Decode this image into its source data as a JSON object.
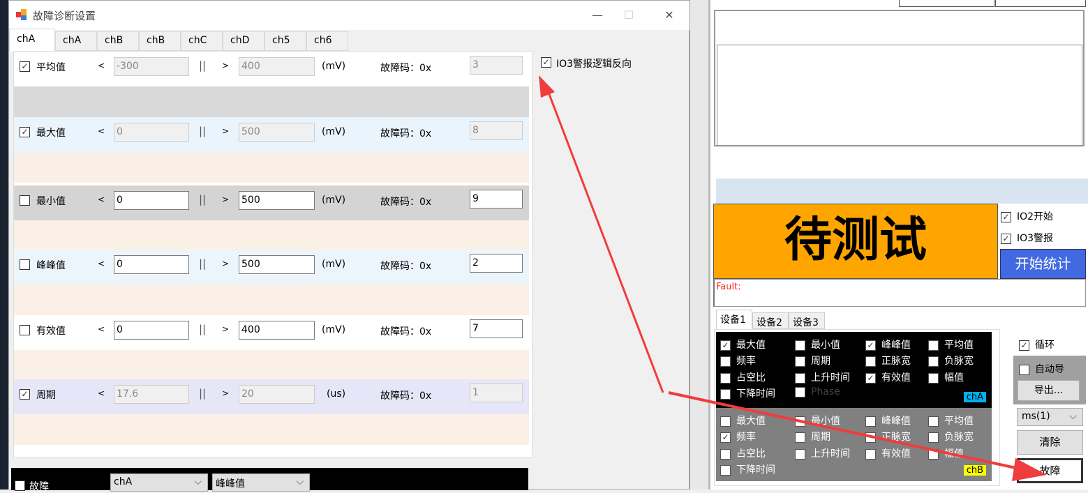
{
  "dialog": {
    "title": "故障诊断设置",
    "window_controls": {
      "minimize": "—",
      "maximize": "☐",
      "close": "✕"
    },
    "tabs": [
      "chA",
      "chA",
      "chB",
      "chB",
      "chC",
      "chD",
      "ch5",
      "ch6"
    ],
    "active_tab": 0,
    "rows": [
      {
        "label": "平均值",
        "checked": true,
        "lt": "<",
        "low": "-300",
        "sep": "||",
        "gt": ">",
        "high": "400",
        "unit": "(mV)",
        "code_label": "故障码：0x",
        "code": "3",
        "enabled": false
      },
      {
        "label": "最大值",
        "checked": true,
        "lt": "<",
        "low": "0",
        "sep": "||",
        "gt": ">",
        "high": "500",
        "unit": "(mV)",
        "code_label": "故障码：0x",
        "code": "8",
        "enabled": false
      },
      {
        "label": "最小值",
        "checked": false,
        "lt": "<",
        "low": "0",
        "sep": "||",
        "gt": ">",
        "high": "500",
        "unit": "(mV)",
        "code_label": "故障码：0x",
        "code": "9",
        "enabled": true
      },
      {
        "label": "峰峰值",
        "checked": false,
        "lt": "<",
        "low": "0",
        "sep": "||",
        "gt": ">",
        "high": "500",
        "unit": "(mV)",
        "code_label": "故障码：0x",
        "code": "2",
        "enabled": true
      },
      {
        "label": "有效值",
        "checked": false,
        "lt": "<",
        "low": "0",
        "sep": "||",
        "gt": ">",
        "high": "400",
        "unit": "(mV)",
        "code_label": "故障码：0x",
        "code": "7",
        "enabled": true
      },
      {
        "label": "周期",
        "checked": true,
        "lt": "<",
        "low": "17.6",
        "sep": "||",
        "gt": ">",
        "high": "20",
        "unit": "(us)",
        "code_label": "故障码：0x",
        "code": "1",
        "enabled": false
      }
    ],
    "io3_invert": {
      "label": "IO3警报逻辑反向",
      "checked": true
    },
    "bottom_bar": {
      "fault_label": "故障",
      "fault_checked": false,
      "channel_select": "chA",
      "measure_select": "峰峰值"
    }
  },
  "right": {
    "status_text": "待测试",
    "status_color": "#ffa500",
    "io2": {
      "label": "IO2开始",
      "checked": true
    },
    "io3": {
      "label": "IO3警报",
      "checked": true
    },
    "start_stats_button": "开始统计",
    "fault_label": "Fault:",
    "device_tabs": [
      "设备1",
      "设备2",
      "设备3"
    ],
    "chA_panel": {
      "badge": "chA",
      "items": [
        {
          "label": "最大值",
          "checked": true
        },
        {
          "label": "最小值",
          "checked": false
        },
        {
          "label": "峰峰值",
          "checked": true
        },
        {
          "label": "平均值",
          "checked": false
        },
        {
          "label": "频率",
          "checked": false
        },
        {
          "label": "周期",
          "checked": false
        },
        {
          "label": "正脉宽",
          "checked": false
        },
        {
          "label": "负脉宽",
          "checked": false
        },
        {
          "label": "占空比",
          "checked": false
        },
        {
          "label": "上升时间",
          "checked": false
        },
        {
          "label": "有效值",
          "checked": true
        },
        {
          "label": "幅值",
          "checked": false
        },
        {
          "label": "下降时间",
          "checked": false
        },
        {
          "label": "Phase",
          "checked": false
        }
      ]
    },
    "chB_panel": {
      "badge": "chB",
      "items": [
        {
          "label": "最大值",
          "checked": false
        },
        {
          "label": "最小值",
          "checked": false
        },
        {
          "label": "峰峰值",
          "checked": false
        },
        {
          "label": "平均值",
          "checked": false
        },
        {
          "label": "频率",
          "checked": true
        },
        {
          "label": "周期",
          "checked": false
        },
        {
          "label": "正脉宽",
          "checked": false
        },
        {
          "label": "负脉宽",
          "checked": false
        },
        {
          "label": "占空比",
          "checked": false
        },
        {
          "label": "上升时间",
          "checked": false
        },
        {
          "label": "有效值",
          "checked": false
        },
        {
          "label": "幅值",
          "checked": false
        },
        {
          "label": "下降时间",
          "checked": false
        }
      ]
    },
    "loop": {
      "label": "循环",
      "checked": true
    },
    "auto_export": {
      "label": "自动导",
      "checked": false
    },
    "export_button": "导出...",
    "unit_select": "ms(1)",
    "clear_button": "清除",
    "fault_button": "故障",
    "colors": {
      "chA_badge": "#00b0f0",
      "chB_badge": "#ffff00",
      "start_button": "#4169e1",
      "annotation_arrow": "#f03c3c"
    }
  }
}
